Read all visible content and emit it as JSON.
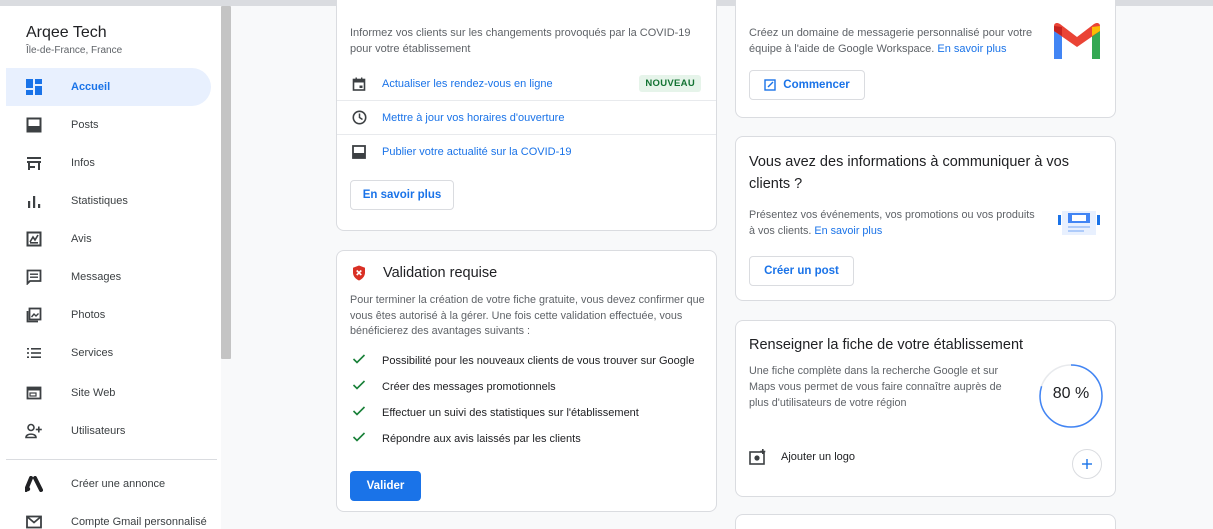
{
  "business": {
    "name": "Arqee Tech",
    "location": "Île-de-France, France"
  },
  "nav": [
    {
      "label": "Accueil",
      "icon": "dashboard-icon",
      "active": true
    },
    {
      "label": "Posts",
      "icon": "posts-icon"
    },
    {
      "label": "Infos",
      "icon": "store-icon"
    },
    {
      "label": "Statistiques",
      "icon": "bar-chart-icon"
    },
    {
      "label": "Avis",
      "icon": "reviews-icon"
    },
    {
      "label": "Messages",
      "icon": "message-icon"
    },
    {
      "label": "Photos",
      "icon": "photos-icon"
    },
    {
      "label": "Services",
      "icon": "list-icon"
    },
    {
      "label": "Site Web",
      "icon": "website-icon"
    },
    {
      "label": "Utilisateurs",
      "icon": "add-user-icon"
    }
  ],
  "nav_extra": [
    {
      "label": "Créer une annonce",
      "icon": "google-ads-icon"
    },
    {
      "label": "Compte Gmail personnalisé",
      "icon": "gmail-icon"
    }
  ],
  "covid_card": {
    "intro": "Informez vos clients sur les changements provoqués par la COVID-19 pour votre établissement",
    "rows": [
      {
        "label": "Actualiser les rendez-vous en ligne",
        "icon": "calendar-icon",
        "badge": "NOUVEAU"
      },
      {
        "label": "Mettre à jour vos horaires d'ouverture",
        "icon": "clock-icon"
      },
      {
        "label": "Publier votre actualité sur la COVID-19",
        "icon": "post-icon"
      }
    ],
    "button": "En savoir plus"
  },
  "validation_card": {
    "title": "Validation requise",
    "body": "Pour terminer la création de votre fiche gratuite, vous devez confirmer que vous êtes autorisé à la gérer. Une fois cette validation effectuée, vous bénéficierez des avantages suivants :",
    "benefits": [
      "Possibilité pour les nouveaux clients de vous trouver sur Google",
      "Créer des messages promotionnels",
      "Effectuer un suivi des statistiques sur l'établissement",
      "Répondre aux avis laissés par les clients"
    ],
    "button": "Valider"
  },
  "gmail_card": {
    "text": "Créez un domaine de messagerie personnalisé pour votre équipe à l'aide de Google Workspace.",
    "link": "En savoir plus",
    "button": "Commencer"
  },
  "post_card": {
    "title": "Vous avez des informations à communiquer à vos clients ?",
    "text": "Présentez vos événements, vos promotions ou vos produits à vos clients.",
    "link": "En savoir plus",
    "button": "Créer un post"
  },
  "profile_card": {
    "title": "Renseigner la fiche de votre établissement",
    "text": "Une fiche complète dans la recherche Google et sur Maps vous permet de vous faire connaître auprès de plus d'utilisateurs de votre région",
    "percent_label": "80 %",
    "percent": 80,
    "action": "Ajouter un logo"
  },
  "colors": {
    "accent": "#1a73e8",
    "success": "#188038",
    "error": "#d93025",
    "active_bg": "#e8f0fe"
  }
}
